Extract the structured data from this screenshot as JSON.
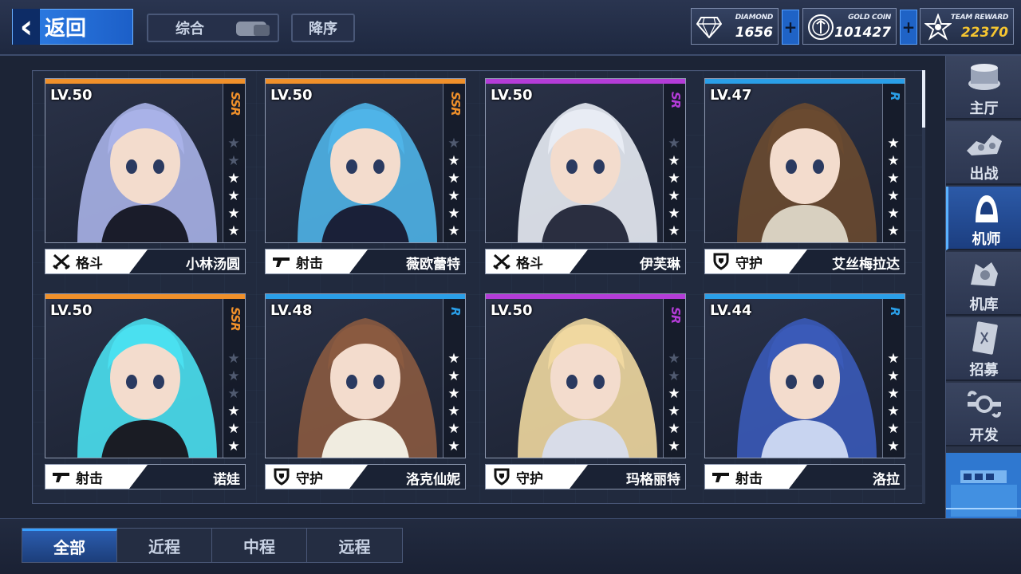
{
  "header": {
    "back_label": "返回",
    "sort_combo_label": "综合",
    "sort_order_label": "降序"
  },
  "resources": {
    "diamond": {
      "label": "DIAMOND",
      "value": "1656",
      "icon": "diamond-icon"
    },
    "gold": {
      "label": "GOLD COIN",
      "value": "101427",
      "icon": "gold-coin-icon"
    },
    "team": {
      "label": "TEAM REWARD",
      "value": "22370",
      "icon": "team-reward-star-icon"
    },
    "plus_label": "+"
  },
  "colors": {
    "ssr": "#f0902a",
    "sr": "#b43cd8",
    "r": "#2a9fe8",
    "accent": "#2f7fe6",
    "team_reward": "#f5c531"
  },
  "pilots": [
    {
      "level": "LV.50",
      "rarity": "SSR",
      "stars": 4,
      "role": "格斗",
      "role_icon": "crossed-swords-icon",
      "name": "小林汤圆",
      "palette": [
        "#a9b2e8",
        "#1a1c2a"
      ]
    },
    {
      "level": "LV.50",
      "rarity": "SSR",
      "stars": 5,
      "role": "射击",
      "role_icon": "gun-icon",
      "name": "薇欧蕾特",
      "palette": [
        "#4fb4e8",
        "#1a2038"
      ]
    },
    {
      "level": "LV.50",
      "rarity": "SR",
      "stars": 5,
      "role": "格斗",
      "role_icon": "crossed-swords-icon",
      "name": "伊芙琳",
      "palette": [
        "#e8ecf4",
        "#2a2e40"
      ]
    },
    {
      "level": "LV.47",
      "rarity": "R",
      "stars": 6,
      "role": "守护",
      "role_icon": "shield-icon",
      "name": "艾丝梅拉达",
      "palette": [
        "#6a4a30",
        "#d8d0c0"
      ]
    },
    {
      "level": "LV.50",
      "rarity": "SSR",
      "stars": 3,
      "role": "射击",
      "role_icon": "gun-icon",
      "name": "诺娃",
      "palette": [
        "#4ae0f0",
        "#1a1c24"
      ]
    },
    {
      "level": "LV.48",
      "rarity": "R",
      "stars": 6,
      "role": "守护",
      "role_icon": "shield-icon",
      "name": "洛克仙妮",
      "palette": [
        "#8a5a40",
        "#f0ece0"
      ]
    },
    {
      "level": "LV.50",
      "rarity": "SR",
      "stars": 4,
      "role": "守护",
      "role_icon": "shield-icon",
      "name": "玛格丽特",
      "palette": [
        "#f0d8a0",
        "#d8dce8"
      ]
    },
    {
      "level": "LV.44",
      "rarity": "R",
      "stars": 6,
      "role": "射击",
      "role_icon": "gun-icon",
      "name": "洛拉",
      "palette": [
        "#3a5ab8",
        "#c8d4f0"
      ]
    }
  ],
  "sidebar": {
    "items": [
      {
        "label": "主厅",
        "icon": "main-hall-icon"
      },
      {
        "label": "出战",
        "icon": "battle-icon"
      },
      {
        "label": "机师",
        "icon": "pilot-icon"
      },
      {
        "label": "机库",
        "icon": "hangar-icon"
      },
      {
        "label": "招募",
        "icon": "recruit-card-icon"
      },
      {
        "label": "开发",
        "icon": "development-wrench-icon"
      }
    ],
    "active_index": 2
  },
  "filter_tabs": [
    "全部",
    "近程",
    "中程",
    "远程"
  ],
  "filter_active": 0
}
